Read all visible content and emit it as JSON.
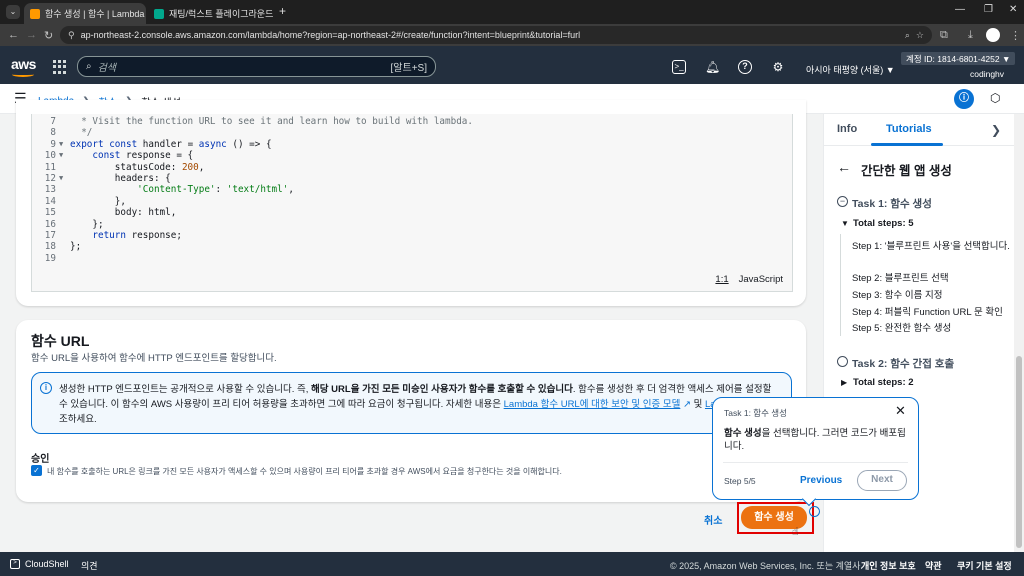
{
  "browser": {
    "tabs": [
      {
        "title": "함수 생성 | 함수 | Lambda",
        "favicon_color": "#ff9900"
      },
      {
        "title": "재팅/럭스트 플레이그라운드 |",
        "favicon_color": "#01a88d"
      }
    ],
    "new_tab": "+",
    "url": "ap-northeast-2.console.aws.amazon.com/lambda/home?region=ap-northeast-2#/create/function?intent=blueprint&tutorial=furl"
  },
  "aws_header": {
    "logo": "aws",
    "search_placeholder": "검색",
    "search_shortcut": "[알트+S]",
    "region": "아시아 태평양 (서울) ▼",
    "account": "계정 ID: 1814-6801-4252 ▼",
    "user": "codinghv"
  },
  "breadcrumb": {
    "items": [
      "Lambda",
      "함수",
      "함수 생성"
    ]
  },
  "code_editor": {
    "lines": [
      {
        "n": "7",
        "text": "  * Visit the function URL to see it and learn how to build with lambda."
      },
      {
        "n": "8",
        "text": "  */"
      },
      {
        "n": "9",
        "text": "export const handler = async () => {"
      },
      {
        "n": "10",
        "text": "    const response = {"
      },
      {
        "n": "11",
        "text": "        statusCode: 200,"
      },
      {
        "n": "12",
        "text": "        headers: {"
      },
      {
        "n": "13",
        "text": "            'Content-Type': 'text/html',"
      },
      {
        "n": "14",
        "text": "        },"
      },
      {
        "n": "15",
        "text": "        body: html,"
      },
      {
        "n": "16",
        "text": "    };"
      },
      {
        "n": "17",
        "text": "    return response;"
      },
      {
        "n": "18",
        "text": "};"
      },
      {
        "n": "19",
        "text": ""
      }
    ],
    "cursor_pos": "1:1",
    "language": "JavaScript"
  },
  "function_url": {
    "title": "함수 URL",
    "description": "함수 URL을 사용하여 함수에 HTTP 엔드포인트를 할당합니다.",
    "info_part1": "생성한 HTTP 엔드포인트는 공개적으로 사용할 수 있습니다. 즉, ",
    "info_bold": "해당 URL을 가진 모든 미승인 사용자가 함수를 호출할 수 있습니다",
    "info_part2": ". 함수를 생성한 후 더 엄격한 액세스 제어를 설정할 수 있습니다. 이 함수의 AWS 사용량이 프리 티어 허용량을 초과하면 그에 따라 요금이 청구됩니다. 자세한 내용은 ",
    "info_link1": "Lambda 함수 URL에 대한 보안 및 인증 모델",
    "info_mid": " 및 ",
    "info_link2": "Lambda",
    "info_end": "조하세요.",
    "ack_label": "승인",
    "ack_text": "내 함수를 호출하는 URL은 링크를 가진 모든 사용자가 액세스할 수 있으며 사용량이 프리 티어를 초과할 경우 AWS에서 요금을 청구한다는 것을 이해합니다."
  },
  "actions": {
    "cancel": "취소",
    "create": "함수 생성"
  },
  "tutorial_panel": {
    "tab_info": "Info",
    "tab_tutorials": "Tutorials",
    "title": "간단한 웹 앱 생성",
    "task1": "Task 1: 함수 생성",
    "total_steps_1": "Total steps: 5",
    "steps": [
      "Step 1: '블루프린트 사용'을 선택합니다.",
      "Step 2: 블루프린트 선택",
      "Step 3: 함수 이름 지정",
      "Step 4: 퍼블릭 Function URL 문 확인",
      "Step 5: 완전한 함수 생성"
    ],
    "task2": "Task 2: 함수 간접 호출",
    "total_steps_2": "Total steps: 2"
  },
  "popover": {
    "header": "Task 1: 함수 생성",
    "body_bold": "함수 생성",
    "body_rest": "을 선택합니다. 그러면 코드가 배포됩니다.",
    "step": "Step 5/5",
    "previous": "Previous",
    "next": "Next"
  },
  "footer": {
    "cloudshell": "CloudShell",
    "feedback": "의견",
    "copyright": "© 2025, Amazon Web Services, Inc. 또는 계열사.",
    "privacy": "개인 정보 보호",
    "terms": "약관",
    "cookies": "쿠키 기본 설정"
  },
  "colors": {
    "aws_nav": "#232f3e",
    "accent_blue": "#0972d3",
    "primary_orange": "#ec7211",
    "highlight_red": "#e10000"
  }
}
